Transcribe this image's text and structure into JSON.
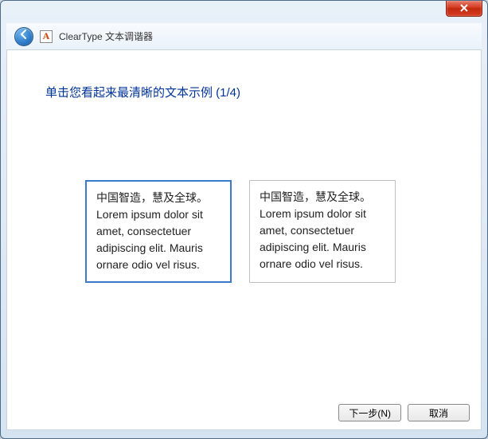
{
  "header": {
    "app_title": "ClearType 文本调谐器",
    "app_icon_letter": "A"
  },
  "content": {
    "heading": "单击您看起来最清晰的文本示例 (1/4)",
    "samples": [
      {
        "selected": true,
        "line1": "中国智造，慧及全球。",
        "line2": "Lorem ipsum dolor sit amet, consectetuer adipiscing elit. Mauris ornare odio vel risus."
      },
      {
        "selected": false,
        "line1": "中国智造，慧及全球。",
        "line2": "Lorem ipsum dolor sit amet, consectetuer adipiscing elit. Mauris ornare odio vel risus."
      }
    ]
  },
  "footer": {
    "next_label": "下一步(N)",
    "cancel_label": "取消"
  }
}
